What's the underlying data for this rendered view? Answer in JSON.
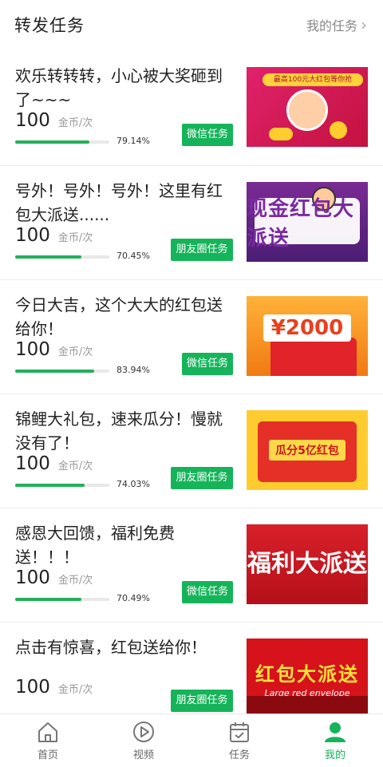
{
  "header": {
    "title": "转发任务",
    "link_label": "我的任务",
    "chevron": "chevron-right-icon"
  },
  "accent_color": "#16b45a",
  "tasks": [
    {
      "title": "欢乐转转转，小心被大奖砸到了~~~",
      "coins": "100",
      "unit": "金币/次",
      "progress": 0.7914,
      "percent": "79.14%",
      "button": "微信任务",
      "thumb_text": "最高100元大红包等你抢"
    },
    {
      "title": "号外！号外！号外！这里有红包大派送......",
      "coins": "100",
      "unit": "金币/次",
      "progress": 0.7045,
      "percent": "70.45%",
      "button": "朋友圈任务",
      "thumb_text": "现金红包大派送"
    },
    {
      "title": "今日大吉，这个大大的红包送给你！",
      "coins": "100",
      "unit": "金币/次",
      "progress": 0.8394,
      "percent": "83.94%",
      "button": "微信任务",
      "thumb_text": "¥2000"
    },
    {
      "title": "锦鲤大礼包，速来瓜分！慢就没有了！",
      "coins": "100",
      "unit": "金币/次",
      "progress": 0.7403,
      "percent": "74.03%",
      "button": "朋友圈任务",
      "thumb_text": "瓜分5亿红包"
    },
    {
      "title": "感恩大回馈，福利免费送！！！",
      "coins": "100",
      "unit": "金币/次",
      "progress": 0.7049,
      "percent": "70.49%",
      "button": "微信任务",
      "thumb_text": "福利大派送"
    },
    {
      "title": "点击有惊喜，红包送给你！",
      "coins": "100",
      "unit": "金币/次",
      "button": "朋友圈任务",
      "thumb_text": "红包大派送",
      "thumb_sub": "Large red envelope"
    }
  ],
  "tabbar": [
    {
      "label": "首页",
      "icon": "home-icon",
      "active": false
    },
    {
      "label": "视频",
      "icon": "play-icon",
      "active": false
    },
    {
      "label": "任务",
      "icon": "task-calendar-icon",
      "active": false
    },
    {
      "label": "我的",
      "icon": "user-icon",
      "active": true
    }
  ]
}
